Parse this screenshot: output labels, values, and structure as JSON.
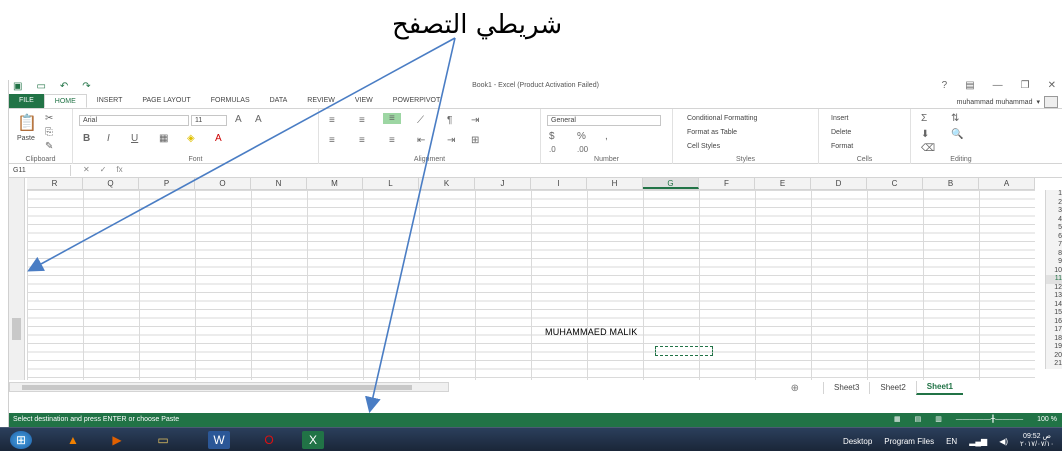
{
  "caption": "شريطي التصفح",
  "window": {
    "title": "Book1 - Excel (Product Activation Failed)",
    "user": "muhammad muhammad"
  },
  "tabs": [
    "FILE",
    "HOME",
    "INSERT",
    "PAGE LAYOUT",
    "FORMULAS",
    "DATA",
    "REVIEW",
    "VIEW",
    "POWERPIVOT"
  ],
  "ribbon": {
    "clipboard": {
      "label": "Clipboard",
      "paste": "Paste"
    },
    "font": {
      "label": "Font",
      "name": "Arial",
      "size": "11"
    },
    "alignment": {
      "label": "Alignment"
    },
    "number": {
      "label": "Number",
      "format": "General"
    },
    "styles": {
      "label": "Styles",
      "conditional": "Conditional Formatting",
      "table": "Format as Table",
      "cell": "Cell Styles"
    },
    "cells": {
      "label": "Cells",
      "insert": "Insert",
      "delete": "Delete",
      "format": "Format"
    },
    "editing": {
      "label": "Editing"
    }
  },
  "formula_bar": {
    "name_box": "G11",
    "fx": "fx"
  },
  "columns": [
    "R",
    "Q",
    "P",
    "O",
    "N",
    "M",
    "L",
    "K",
    "J",
    "I",
    "H",
    "G",
    "F",
    "E",
    "D",
    "C",
    "B",
    "A"
  ],
  "selected_column": "G",
  "rows": [
    "1",
    "2",
    "3",
    "4",
    "5",
    "6",
    "7",
    "8",
    "9",
    "10",
    "11",
    "12",
    "13",
    "14",
    "15",
    "16",
    "17",
    "18",
    "19",
    "20",
    "21"
  ],
  "selected_row": "11",
  "cell_text": "MUHAMMAED   MALIK",
  "sheets": [
    "Sheet3",
    "Sheet2",
    "Sheet1"
  ],
  "active_sheet": "Sheet1",
  "status_text": "Select destination and press ENTER or choose Paste",
  "zoom": "100 %",
  "taskbar": {
    "desktop": "Desktop",
    "program_files": "Program Files",
    "lang": "EN",
    "time": "09:52 ص",
    "date": "٢٠١٧/٠٧/١٠"
  }
}
